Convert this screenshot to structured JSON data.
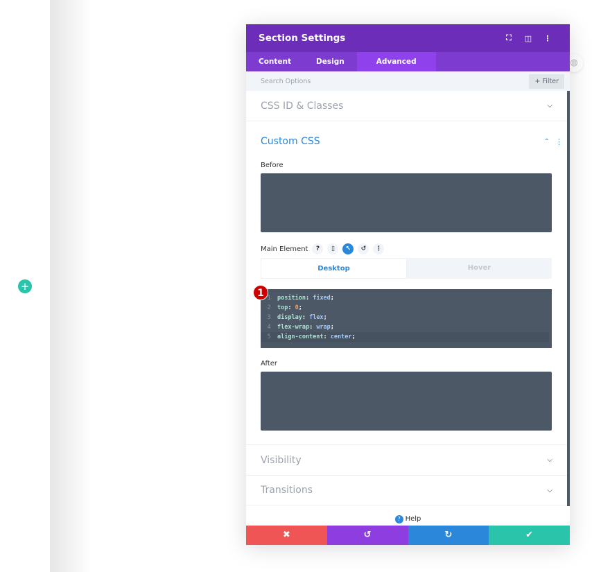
{
  "colors": {
    "header": "#6c2eb9",
    "tabs": "#7e3bd0",
    "active_tab": "#8f42ec",
    "accent": "#2b87da",
    "discard": "#ef5555",
    "undo": "#8e3ee0",
    "redo": "#2b87da",
    "save": "#29c4a9"
  },
  "builder": {
    "add_icon": "+"
  },
  "modal": {
    "title": "Section Settings",
    "header_icons": {
      "fullscreen": "⛶",
      "split": "◫",
      "menu": "⋮"
    },
    "tabs": [
      {
        "label": "Content"
      },
      {
        "label": "Design"
      },
      {
        "label": "Advanced"
      }
    ],
    "search": {
      "placeholder": "Search Options",
      "filter_label": "+ Filter"
    },
    "sections": {
      "css_id": "CSS ID & Classes",
      "custom_css": "Custom CSS",
      "visibility": "Visibility",
      "transitions": "Transitions"
    },
    "custom_css": {
      "before_label": "Before",
      "main_element_label": "Main Element",
      "icons": {
        "help": "?",
        "device": "▯",
        "hover": "↖",
        "reset": "↺",
        "more": "⋮"
      },
      "state_tabs": {
        "desktop": "Desktop",
        "hover": "Hover"
      },
      "badge": "1",
      "code": [
        {
          "n": "1",
          "prop": "position",
          "val": "fixed"
        },
        {
          "n": "2",
          "prop": "top",
          "val": "0"
        },
        {
          "n": "3",
          "prop": "display",
          "val": "flex"
        },
        {
          "n": "4",
          "prop": "flex-wrap",
          "val": "wrap"
        },
        {
          "n": "5",
          "prop": "align-content",
          "val": "center"
        }
      ],
      "after_label": "After"
    },
    "help_label": "Help",
    "footer": {
      "discard": "✖",
      "undo": "↺",
      "redo": "↻",
      "save": "✔"
    }
  }
}
